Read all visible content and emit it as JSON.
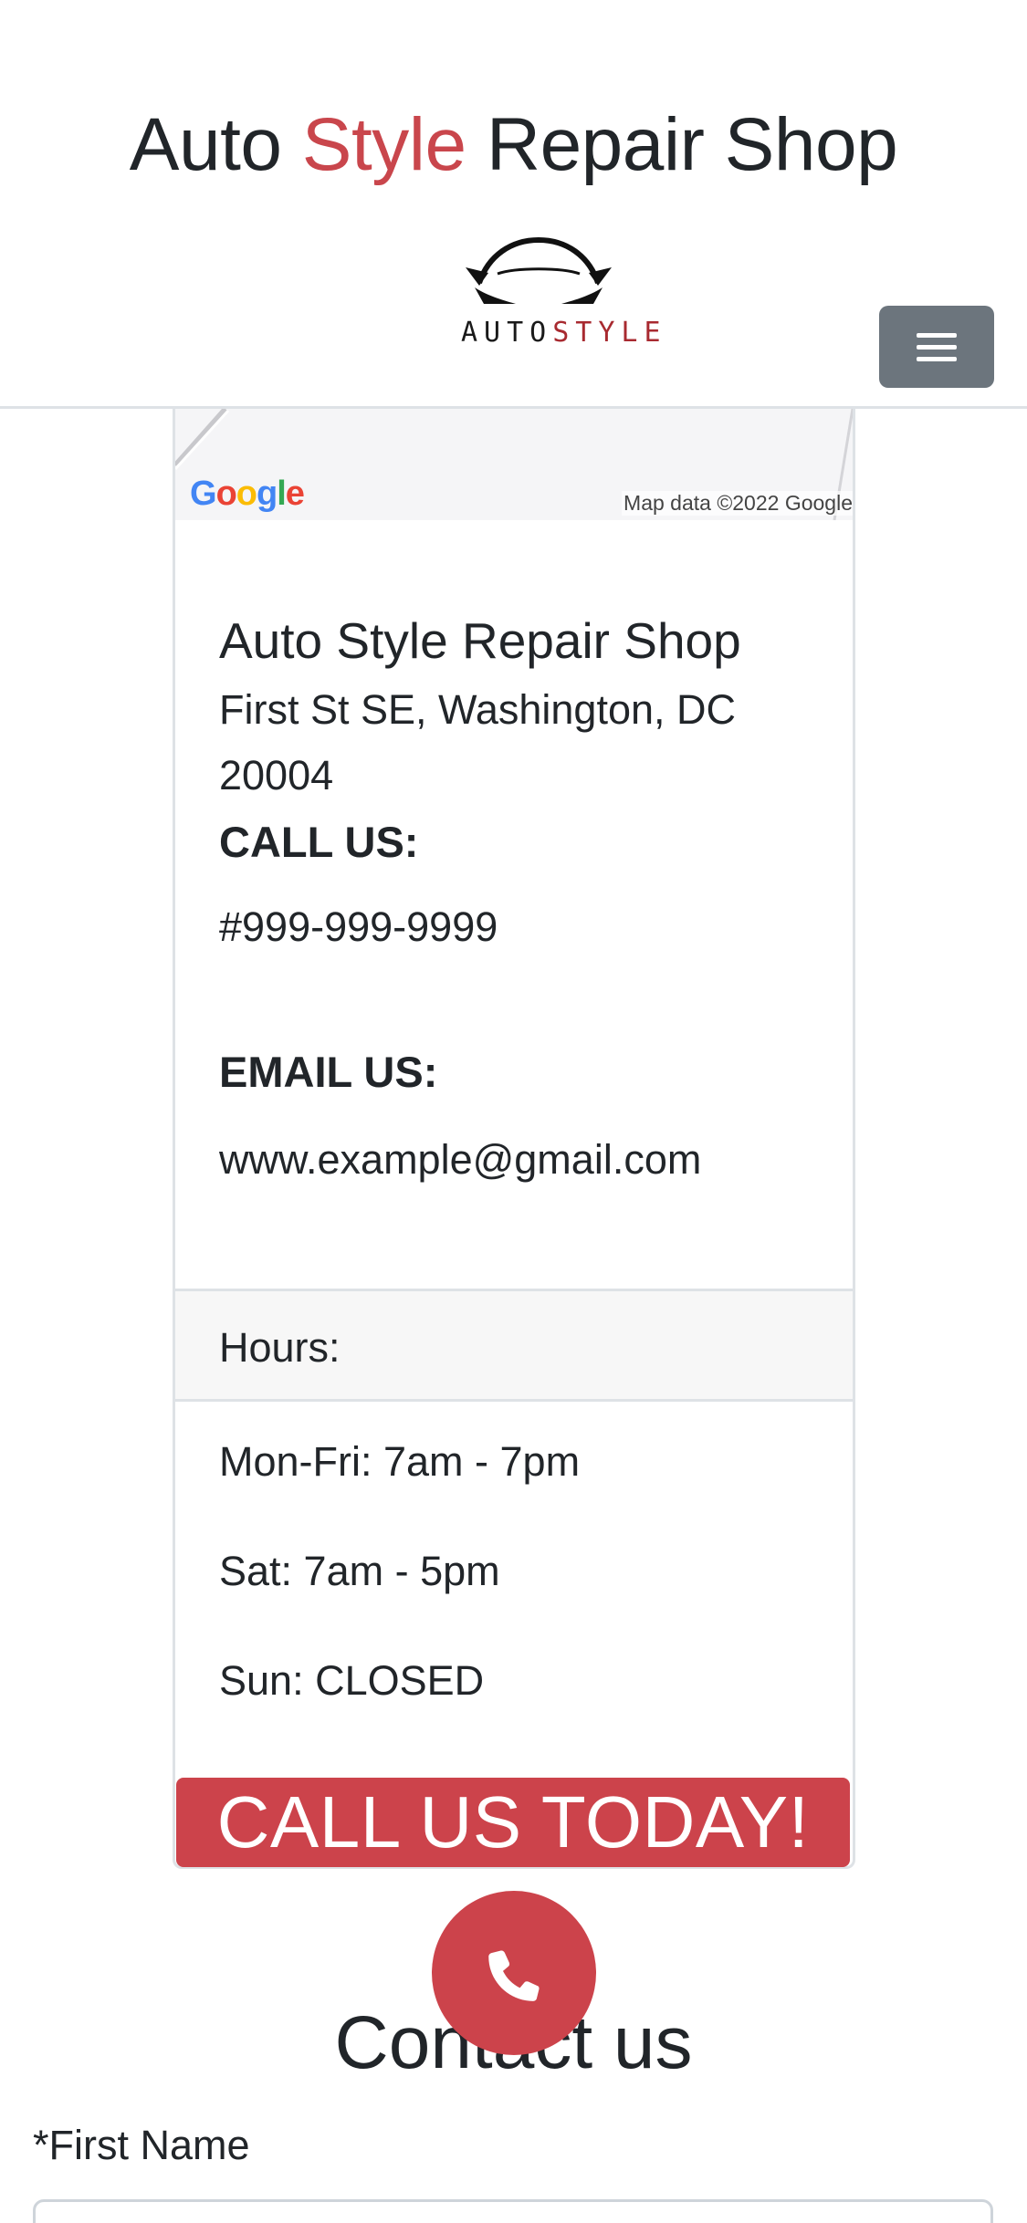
{
  "header": {
    "title_part1": "Auto ",
    "title_accent": "Style",
    "title_part2": " Repair Shop",
    "logo_auto": "AUTO",
    "logo_style": "STYLE",
    "menu_icon": "hamburger-icon"
  },
  "map": {
    "google_logo": [
      "G",
      "o",
      "o",
      "g",
      "l",
      "e"
    ],
    "credit": "Map data ©2022 Google"
  },
  "business": {
    "name": "Auto Style Repair Shop",
    "address": "First St SE, Washington, DC 20004",
    "call_label": "CALL US:",
    "phone": "#999-999-9999",
    "email_label": "EMAIL US:",
    "email": "www.example@gmail.com"
  },
  "hours": {
    "header": "Hours:",
    "lines": [
      "Mon-Fri: 7am - 7pm",
      "Sat: 7am - 5pm",
      "Sun: CLOSED"
    ]
  },
  "cta": {
    "banner": "CALL US TODAY!",
    "fab_icon": "phone-icon"
  },
  "contact": {
    "heading": "Contact us",
    "first_name_label": "*First Name",
    "first_name_value": ""
  },
  "colors": {
    "accent": "#c9464c",
    "cta": "#cc434b",
    "menu_button": "#6c757d"
  }
}
